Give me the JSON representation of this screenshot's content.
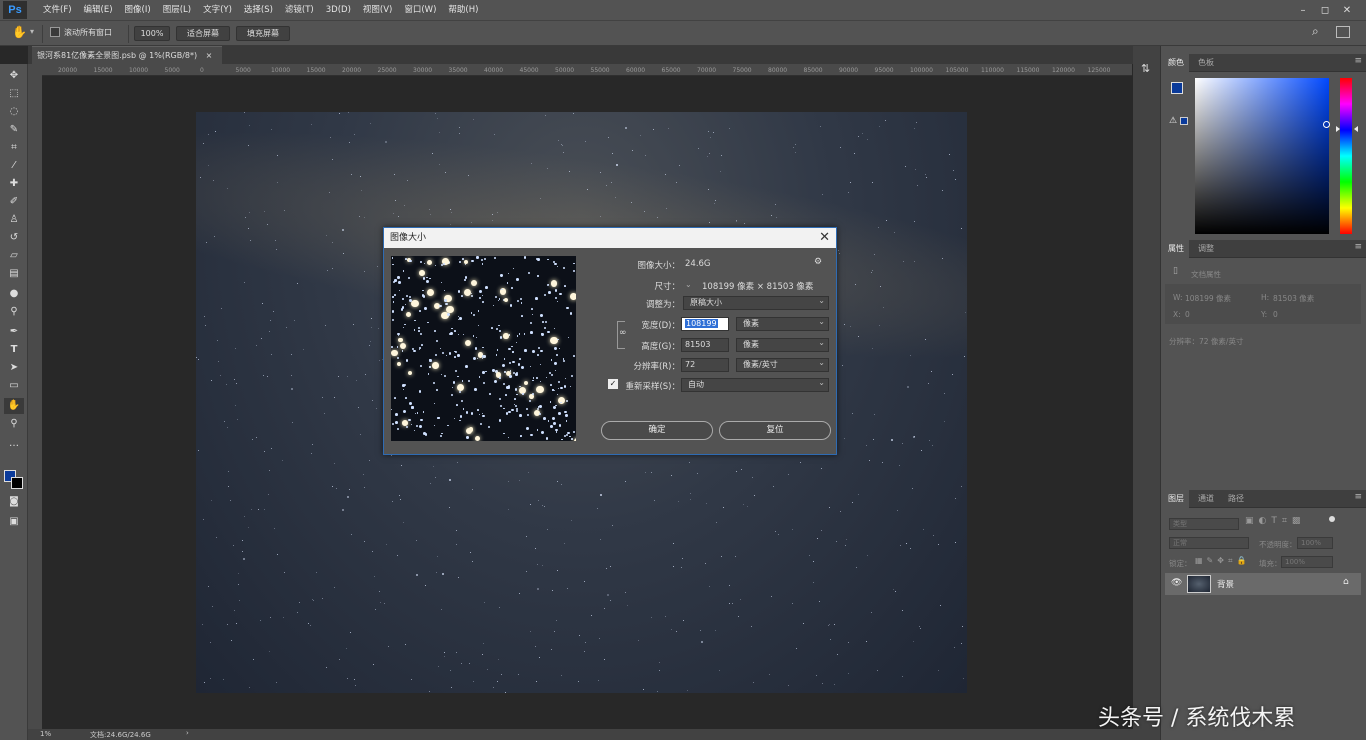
{
  "app": {
    "logo": "Ps"
  },
  "menu": [
    "文件(F)",
    "编辑(E)",
    "图像(I)",
    "图层(L)",
    "文字(Y)",
    "选择(S)",
    "滤镜(T)",
    "3D(D)",
    "视图(V)",
    "窗口(W)",
    "帮助(H)"
  ],
  "window_controls": {
    "minimize": "–",
    "restore": "◻",
    "close": "✕"
  },
  "options_bar": {
    "scroll_all_label": "滚动所有窗口",
    "zoom_value": "100%",
    "fit_screen": "适合屏幕",
    "fill_screen": "填充屏幕"
  },
  "document": {
    "tab_title": "银河系81亿像素全景图.psb @ 1%(RGB/8*)",
    "tab_close": "×"
  },
  "ruler_ticks": [
    "20000",
    "15000",
    "10000",
    "5000",
    "0",
    "5000",
    "10000",
    "15000",
    "20000",
    "25000",
    "30000",
    "35000",
    "40000",
    "45000",
    "50000",
    "55000",
    "60000",
    "65000",
    "70000",
    "75000",
    "80000",
    "85000",
    "90000",
    "95000",
    "100000",
    "105000",
    "110000",
    "115000",
    "120000",
    "125000"
  ],
  "status": {
    "zoom": "1%",
    "doc_info": "文档:24.6G/24.6G"
  },
  "dialog": {
    "title": "图像大小",
    "close": "✕",
    "image_size_label": "图像大小：",
    "image_size_value": "24.6G",
    "dimensions_label": "尺寸：",
    "dimensions_value": "108199 像素  ×  81503 像素",
    "fit_to_label": "调整为：",
    "fit_to_value": "原稿大小",
    "width_label": "宽度(D)：",
    "width_value": "108199",
    "width_unit": "像素",
    "height_label": "高度(G)：",
    "height_value": "81503",
    "height_unit": "像素",
    "resolution_label": "分辨率(R)：",
    "resolution_value": "72",
    "resolution_unit": "像素/英寸",
    "resample_label": "重新采样(S)：",
    "resample_checked": true,
    "resample_value": "自动",
    "ok_button": "确定",
    "reset_button": "复位"
  },
  "color_panel": {
    "tabs": [
      "颜色",
      "色板"
    ],
    "foreground": "#0a3a9a",
    "background": "#000000"
  },
  "properties_panel": {
    "tabs": [
      "属性",
      "调整"
    ],
    "doc_props": "文档属性",
    "w_label": "W:",
    "w_value": "108199 像素",
    "h_label": "H:",
    "h_value": "81503 像素",
    "x_label": "X:",
    "x_value": "0",
    "y_label": "Y:",
    "y_value": "0",
    "resolution": "分辨率：72 像素/英寸"
  },
  "layers_panel": {
    "tabs": [
      "图层",
      "通道",
      "路径"
    ],
    "filter_kind": "类型",
    "blend_mode": "正常",
    "opacity_label": "不透明度：",
    "opacity_value": "100%",
    "lock_label": "锁定：",
    "fill_label": "填充：",
    "fill_value": "100%",
    "layer_name": "背景"
  },
  "watermark": "头条号 / 系统伐木累"
}
